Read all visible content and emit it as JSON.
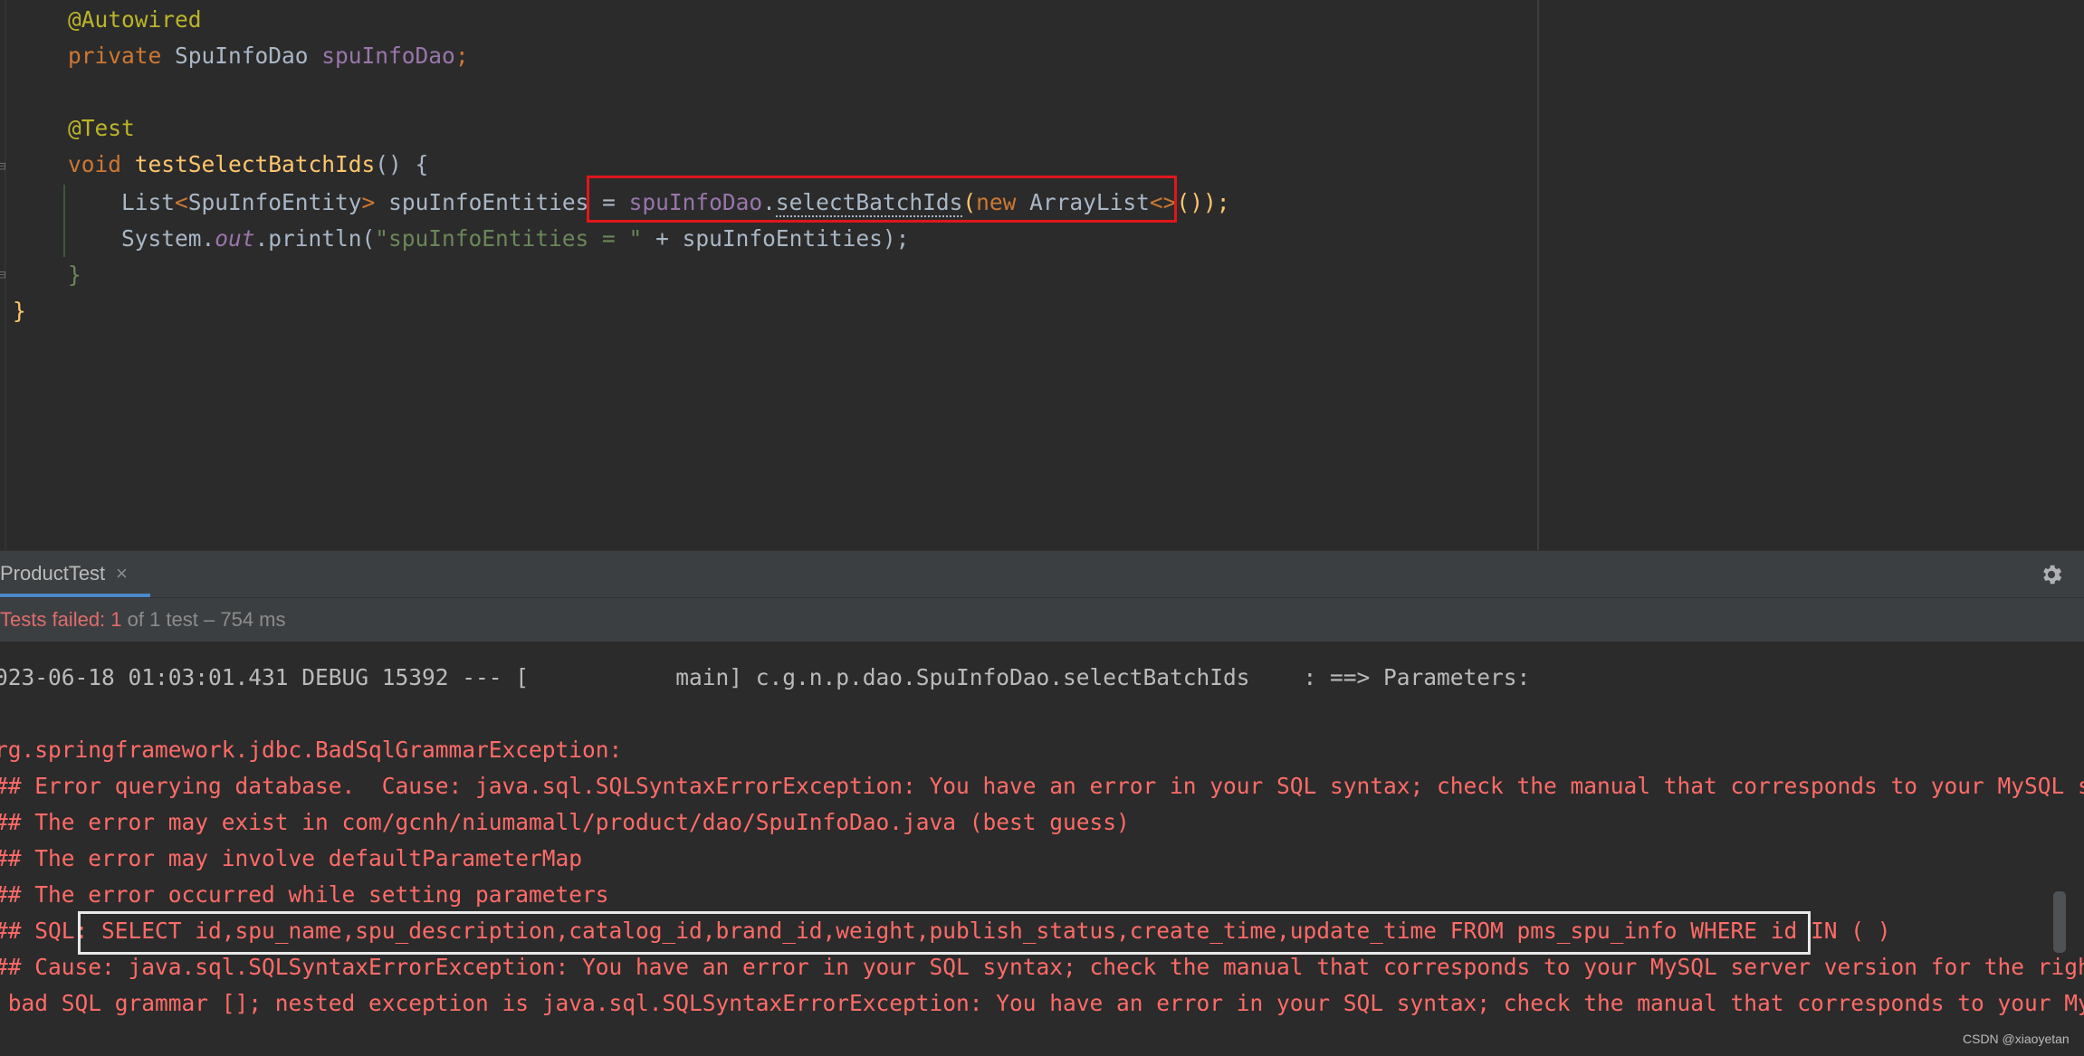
{
  "editor": {
    "lines": [
      {
        "parts": [
          {
            "t": "    ",
            "c": ""
          },
          {
            "t": "@Autowired",
            "c": "ann"
          }
        ]
      },
      {
        "parts": [
          {
            "t": "    ",
            "c": ""
          },
          {
            "t": "private ",
            "c": "kw"
          },
          {
            "t": "SpuInfoDao ",
            "c": ""
          },
          {
            "t": "spuInfoDao",
            "c": "fld"
          },
          {
            "t": ";",
            "c": "kw"
          }
        ]
      },
      {
        "parts": [
          {
            "t": "",
            "c": ""
          }
        ]
      },
      {
        "parts": [
          {
            "t": "    ",
            "c": ""
          },
          {
            "t": "@Test",
            "c": "ann"
          }
        ]
      },
      {
        "parts": [
          {
            "t": "    ",
            "c": ""
          },
          {
            "t": "void ",
            "c": "kw"
          },
          {
            "t": "testSelectBatchIds",
            "c": "fn"
          },
          {
            "t": "() {",
            "c": ""
          }
        ]
      },
      {
        "parts": [
          {
            "t": "        List",
            "c": ""
          },
          {
            "t": "<",
            "c": "kw"
          },
          {
            "t": "SpuInfoEntity",
            "c": ""
          },
          {
            "t": "> ",
            "c": "kw"
          },
          {
            "t": "spuInfoEntities = ",
            "c": ""
          },
          {
            "t": "spuInfoDao",
            "c": "fld"
          },
          {
            "t": ".",
            "c": ""
          },
          {
            "t": "selectBatchIds",
            "c": "dotted"
          },
          {
            "t": "(",
            "c": "fn"
          },
          {
            "t": "new ",
            "c": "kw"
          },
          {
            "t": "ArrayList",
            "c": ""
          },
          {
            "t": "<>",
            "c": "kw"
          },
          {
            "t": "());",
            "c": "fn"
          }
        ]
      },
      {
        "parts": [
          {
            "t": "        System.",
            "c": ""
          },
          {
            "t": "out",
            "c": "ital"
          },
          {
            "t": ".println(",
            "c": ""
          },
          {
            "t": "\"spuInfoEntities = \"",
            "c": "str"
          },
          {
            "t": " + spuInfoEntities);",
            "c": ""
          }
        ]
      },
      {
        "parts": [
          {
            "t": "    }",
            "c": "str"
          }
        ]
      },
      {
        "parts": [
          {
            "t": "}",
            "c": "fn"
          }
        ]
      }
    ]
  },
  "run": {
    "tab_label": "ProductTest",
    "tab_close": "×",
    "status_failed": "Tests failed: 1",
    "status_rest": " of 1 test – 754 ms",
    "icons": {
      "settings": "gear-icon",
      "close": "close-icon"
    }
  },
  "console": {
    "lines": [
      {
        "text": "023-06-18 01:03:01.431 DEBUG 15392 --- [           main] c.g.n.p.dao.SpuInfoDao.selectBatchIds    : ==> Parameters: ",
        "kind": "normal"
      },
      {
        "text": "",
        "kind": "normal"
      },
      {
        "text": "rg.springframework.jdbc.BadSqlGrammarException: ",
        "kind": "err"
      },
      {
        "text": "## Error querying database.  Cause: java.sql.SQLSyntaxErrorException: You have an error in your SQL syntax; check the manual that corresponds to your MySQL server v",
        "kind": "err"
      },
      {
        "text": "## The error may exist in com/gcnh/niumamall/product/dao/SpuInfoDao.java (best guess)",
        "kind": "err"
      },
      {
        "text": "## The error may involve defaultParameterMap",
        "kind": "err"
      },
      {
        "text": "## The error occurred while setting parameters",
        "kind": "err"
      },
      {
        "text": "## SQL: SELECT id,spu_name,spu_description,catalog_id,brand_id,weight,publish_status,create_time,update_time FROM pms_spu_info WHERE id IN ( )",
        "kind": "err"
      },
      {
        "text": "## Cause: java.sql.SQLSyntaxErrorException: You have an error in your SQL syntax; check the manual that corresponds to your MySQL server version for the right synta",
        "kind": "err"
      },
      {
        "text": " bad SQL grammar []; nested exception is java.sql.SQLSyntaxErrorException: You have an error in your SQL syntax; check the manual that corresponds to your MySQL ser",
        "kind": "err"
      }
    ],
    "watermark": "CSDN @xiaoyetan"
  }
}
